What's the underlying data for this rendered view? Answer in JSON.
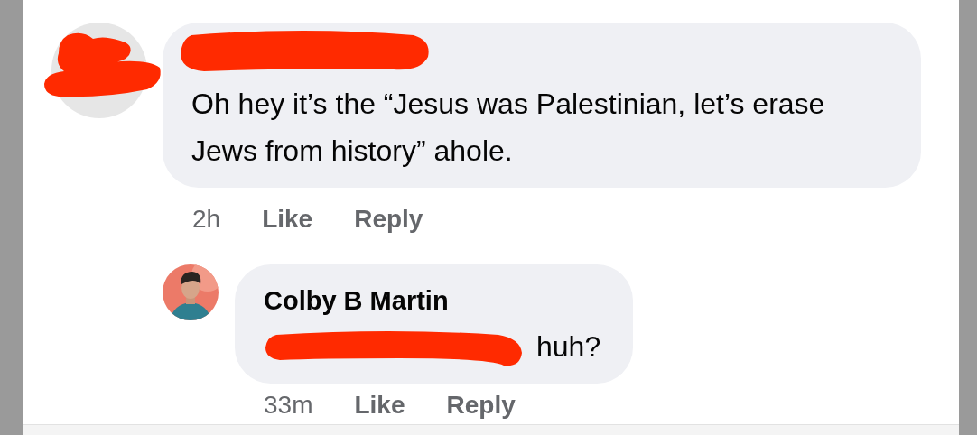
{
  "comments": [
    {
      "author_redacted": true,
      "text": "Oh hey it’s the “Jesus was Palestinian, let’s erase Jews from history” ahole.",
      "time": "2h",
      "actions": [
        "Like",
        "Reply"
      ],
      "replies": [
        {
          "author": "Colby B Martin",
          "mention_redacted": true,
          "text": "huh?",
          "time": "33m",
          "actions": [
            "Like",
            "Reply"
          ]
        }
      ]
    }
  ]
}
